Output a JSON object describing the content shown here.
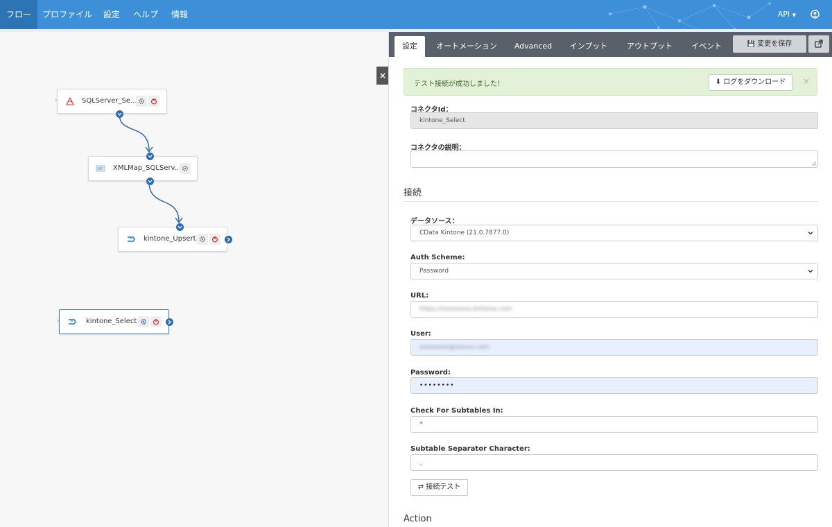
{
  "nav": {
    "items": [
      "フロー",
      "プロファイル",
      "設定",
      "ヘルプ",
      "情報"
    ],
    "api_label": "API",
    "accent": "#3d8fd8"
  },
  "flow": {
    "nodes": [
      {
        "label": "SQLServer_Se..."
      },
      {
        "label": "XMLMap_SQLServ..."
      },
      {
        "label": "kintone_Upsert"
      },
      {
        "label": "kintone_Select"
      }
    ],
    "close_label": "×"
  },
  "panel": {
    "tabs": [
      "設定",
      "オートメーション",
      "Advanced",
      "インプット",
      "アウトプット",
      "イベント"
    ],
    "save_label": "変更を保存",
    "alert": {
      "message": "テスト接続が成功しました！",
      "download_label": "ログをダウンロード",
      "close": "×"
    },
    "connector_id_label": "コネクタId：",
    "connector_id_value": "kintone_Select",
    "connector_desc_label": "コネクタの説明：",
    "connection_heading": "接続",
    "datasource_label": "データソース：",
    "datasource_value": "CData Kintone (21.0.7877.0)",
    "auth_label": "Auth Scheme:",
    "auth_value": "Password",
    "url_label": "URL:",
    "url_value": "https://xxxxxxxx.kintone.com",
    "user_label": "User:",
    "user_value": "xxxxxxxx@xxxxx.com",
    "password_label": "Password:",
    "password_value": "••••••••",
    "subtables_label": "Check For Subtables In:",
    "subtables_value": "*",
    "separator_label": "Subtable Separator Character:",
    "separator_value": "_",
    "test_label": "接続テスト",
    "action_heading": "Action"
  }
}
